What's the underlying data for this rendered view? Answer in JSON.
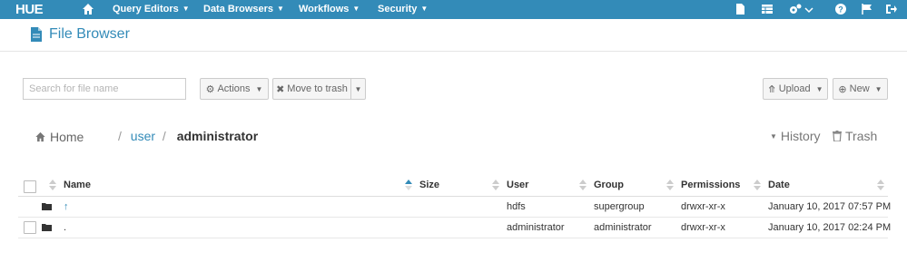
{
  "navbar": {
    "logo": "HUE",
    "menus": [
      {
        "label": "Query Editors"
      },
      {
        "label": "Data Browsers"
      },
      {
        "label": "Workflows"
      },
      {
        "label": "Security"
      }
    ],
    "right_icons": [
      "document-icon",
      "table-icon",
      "cogs-icon",
      "help-icon",
      "flag-icon",
      "sign-out-icon"
    ]
  },
  "page": {
    "title": "File Browser",
    "title_icon": "file-icon"
  },
  "toolbar": {
    "search_placeholder": "Search for file name",
    "actions_label": "Actions",
    "move_to_trash_label": "Move to trash",
    "upload_label": "Upload",
    "new_label": "New"
  },
  "breadcrumb": {
    "home_label": "Home",
    "sep1": "/",
    "path1": "user",
    "sep2": "/",
    "current": "administrator",
    "history_label": "History",
    "trash_label": "Trash"
  },
  "table": {
    "columns": [
      "Name",
      "Size",
      "User",
      "Group",
      "Permissions",
      "Date"
    ],
    "rows": [
      {
        "name": "↑",
        "size": "",
        "user": "hdfs",
        "group": "supergroup",
        "permissions": "drwxr-xr-x",
        "date": "January 10, 2017 07:57 PM",
        "has_checkbox": false
      },
      {
        "name": ".",
        "size": "",
        "user": "administrator",
        "group": "administrator",
        "permissions": "drwxr-xr-x",
        "date": "January 10, 2017 02:24 PM",
        "has_checkbox": true
      }
    ]
  },
  "colors": {
    "navbar": "#338bb8",
    "link": "#338bb8",
    "text": "#333333"
  }
}
